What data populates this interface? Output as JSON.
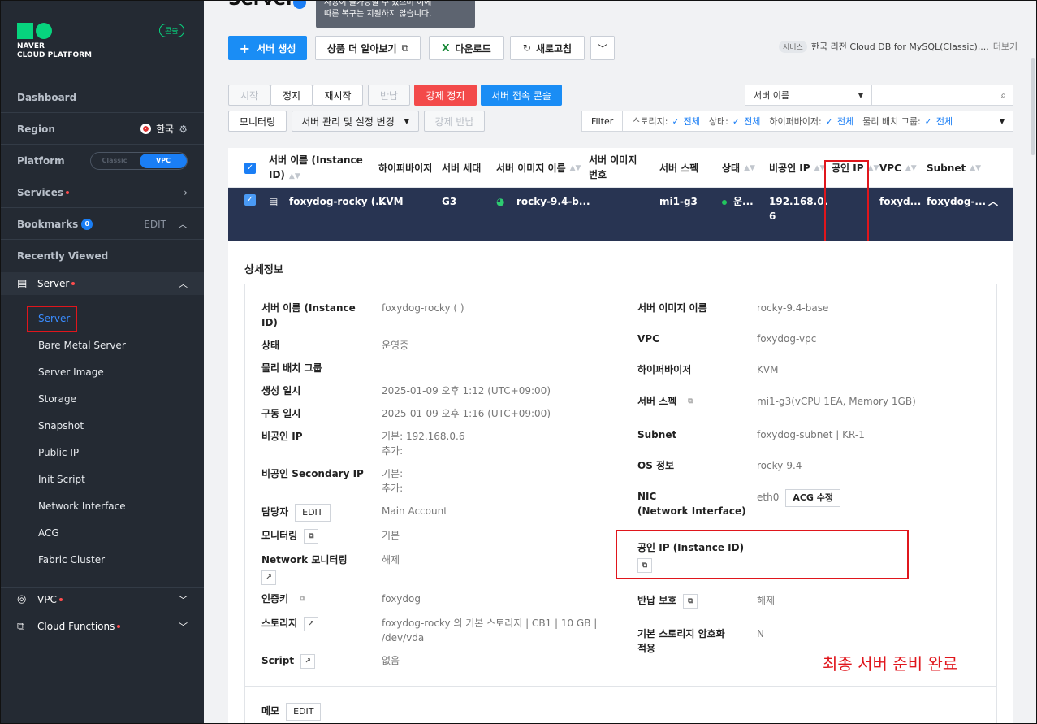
{
  "sidebar": {
    "brand_line1": "NAVER",
    "brand_line2": "CLOUD PLATFORM",
    "console_label": "콘솔",
    "dashboard": "Dashboard",
    "region_label": "Region",
    "region_value": "한국",
    "platform_label": "Platform",
    "platform_classic": "Classic",
    "platform_vpc": "VPC",
    "services": "Services",
    "bookmarks": "Bookmarks",
    "bookmarks_count": "0",
    "bookmarks_edit": "EDIT",
    "recently_viewed": "Recently Viewed",
    "server_section": "Server",
    "server_items": [
      "Server",
      "Bare Metal Server",
      "Server Image",
      "Storage",
      "Snapshot",
      "Public IP",
      "Init Script",
      "Network Interface",
      "ACG",
      "Fabric Cluster"
    ],
    "vpc_section": "VPC",
    "cloud_functions_section": "Cloud Functions"
  },
  "header": {
    "title": "Server",
    "tooltip_line1": "사용이 불가능할 수 있으며 이에",
    "tooltip_line2": "따른 복구는 지원하지 않습니다.",
    "create_button": "서버 생성",
    "learn_more_button": "상품 더 알아보기",
    "download_button": "다운로드",
    "refresh_button": "새로고침",
    "service_tag": "서비스",
    "service_text": "한국 리전 Cloud DB for MySQL(Classic),...",
    "service_more": "더보기"
  },
  "actions": {
    "start": "시작",
    "stop": "정지",
    "restart": "재시작",
    "return": "반납",
    "force_stop": "강제 정지",
    "console_access": "서버 접속 콘솔",
    "monitoring": "모니터링",
    "manage_settings": "서버 관리 및 설정 변경",
    "force_return": "강제 반납"
  },
  "search": {
    "field_select": "서버 이름"
  },
  "filter": {
    "label": "Filter",
    "items": [
      {
        "name": "스토리지:",
        "value": "전체"
      },
      {
        "name": "상태:",
        "value": "전체"
      },
      {
        "name": "하이퍼바이저:",
        "value": "전체"
      },
      {
        "name": "물리 배치 그룹:",
        "value": "전체"
      }
    ]
  },
  "table": {
    "headers": {
      "name_line1": "서버 이름 (Instance",
      "name_line2": "ID)",
      "hypervisor": "하이퍼바이저",
      "generation": "서버 세대",
      "image_name": "서버 이미지 이름",
      "image_no_line1": "서버 이미지",
      "image_no_line2": "번호",
      "spec": "서버 스펙",
      "status": "상태",
      "private_ip": "비공인 IP",
      "public_ip": "공인 IP",
      "vpc": "VPC",
      "subnet": "Subnet"
    },
    "row": {
      "name": "foxydog-rocky (...",
      "hypervisor": "KVM",
      "generation": "G3",
      "image_name": "rocky-9.4-b...",
      "spec": "mi1-g3",
      "status": "운...",
      "private_ip_line1": "192.168.0.",
      "private_ip_line2": "6",
      "vpc": "foxyd...",
      "subnet": "foxydog-..."
    }
  },
  "detail": {
    "title": "상세정보",
    "left": {
      "name_label_line1": "서버 이름 (Instance",
      "name_label_line2": "ID)",
      "name_value": "foxydog-rocky (                  )",
      "status_label": "상태",
      "status_value": "운영중",
      "placement_label": "물리 배치 그룹",
      "created_label": "생성 일시",
      "created_value": "2025-01-09 오후 1:12 (UTC+09:00)",
      "started_label": "구동 일시",
      "started_value": "2025-01-09 오후 1:16 (UTC+09:00)",
      "private_ip_label": "비공인 IP",
      "private_ip_value1": "기본: 192.168.0.6",
      "private_ip_value2": "추가:",
      "secondary_ip_label": "비공인 Secondary IP",
      "secondary_ip_value1": "기본:",
      "secondary_ip_value2": "추가:",
      "manager_label": "담당자",
      "manager_edit": "EDIT",
      "manager_value": "Main Account",
      "monitoring_label": "모니터링",
      "monitoring_value": "기본",
      "net_monitoring_label": "Network 모니터링",
      "net_monitoring_value": "해제",
      "authkey_label": "인증키",
      "authkey_value": "foxydog",
      "storage_label": "스토리지",
      "storage_value1": "foxydog-rocky 의 기본 스토리지 | CB1 | 10 GB |",
      "storage_value2": "/dev/vda",
      "script_label": "Script",
      "script_value": "없음",
      "memo_label": "메모",
      "memo_edit": "EDIT"
    },
    "right": {
      "image_label": "서버 이미지 이름",
      "image_value": "rocky-9.4-base",
      "vpc_label": "VPC",
      "vpc_value": "foxydog-vpc",
      "hypervisor_label": "하이퍼바이저",
      "hypervisor_value": "KVM",
      "spec_label": "서버 스펙",
      "spec_value": "mi1-g3(vCPU 1EA, Memory 1GB)",
      "subnet_label": "Subnet",
      "subnet_value": "foxydog-subnet | KR-1",
      "os_label": "OS 정보",
      "os_value": "rocky-9.4",
      "nic_label_line1": "NIC",
      "nic_label_line2": "(Network Interface)",
      "nic_value": "eth0",
      "acg_button": "ACG 수정",
      "public_ip_label": "공인 IP (Instance ID)",
      "return_protect_label": "반납 보호",
      "return_protect_value": "해제",
      "encrypt_label_line1": "기본 스토리지 암호화",
      "encrypt_label_line2": "적용",
      "encrypt_value": "N"
    }
  },
  "annotation": {
    "final_note": "최종 서버 준비 완료"
  },
  "colors": {
    "accent": "#1a8df5",
    "danger": "#f34a4a",
    "sidebar_bg": "#242a33",
    "selected_row": "#283452",
    "brand_green": "#07d47e",
    "annotation_red": "#e0161c"
  }
}
